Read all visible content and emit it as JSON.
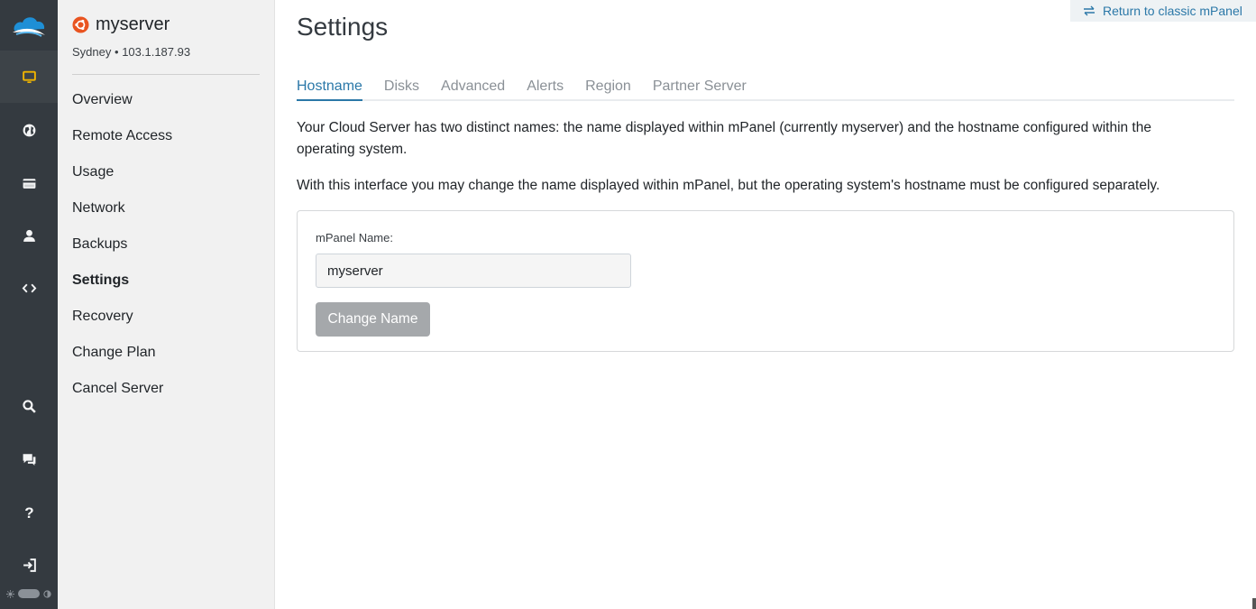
{
  "rail": {
    "items": [
      {
        "icon": "monitor-icon",
        "active": true
      },
      {
        "icon": "globe-icon"
      },
      {
        "icon": "credit-card-icon"
      },
      {
        "icon": "user-icon"
      },
      {
        "icon": "code-icon"
      },
      {
        "icon": "search-icon"
      },
      {
        "icon": "chat-icon"
      },
      {
        "icon": "help-icon",
        "glyph": "?"
      },
      {
        "icon": "logout-icon"
      }
    ],
    "accent": "#f0b400"
  },
  "server": {
    "name": "myserver",
    "location": "Sydney",
    "separator": "•",
    "ip": "103.1.187.93",
    "os_icon": "ubuntu-icon"
  },
  "nav": {
    "items": [
      "Overview",
      "Remote Access",
      "Usage",
      "Network",
      "Backups",
      "Settings",
      "Recovery",
      "Change Plan",
      "Cancel Server"
    ],
    "active": "Settings"
  },
  "header": {
    "return_link": "Return to classic mPanel",
    "title": "Settings"
  },
  "tabs": {
    "items": [
      "Hostname",
      "Disks",
      "Advanced",
      "Alerts",
      "Region",
      "Partner Server"
    ],
    "active": "Hostname"
  },
  "content": {
    "paragraph1": "Your Cloud Server has two distinct names: the name displayed within mPanel (currently myserver) and the hostname configured within the operating system.",
    "paragraph2": "With this interface you may change the name displayed within mPanel, but the operating system's hostname must be configured separately."
  },
  "form": {
    "label": "mPanel Name:",
    "value": "myserver",
    "button": "Change Name"
  },
  "colors": {
    "rail_bg": "#343a40",
    "sidebar_bg": "#f1f1f1",
    "link": "#2b78a8",
    "button_disabled": "#a5a8ab",
    "os_icon": "#e95420"
  }
}
